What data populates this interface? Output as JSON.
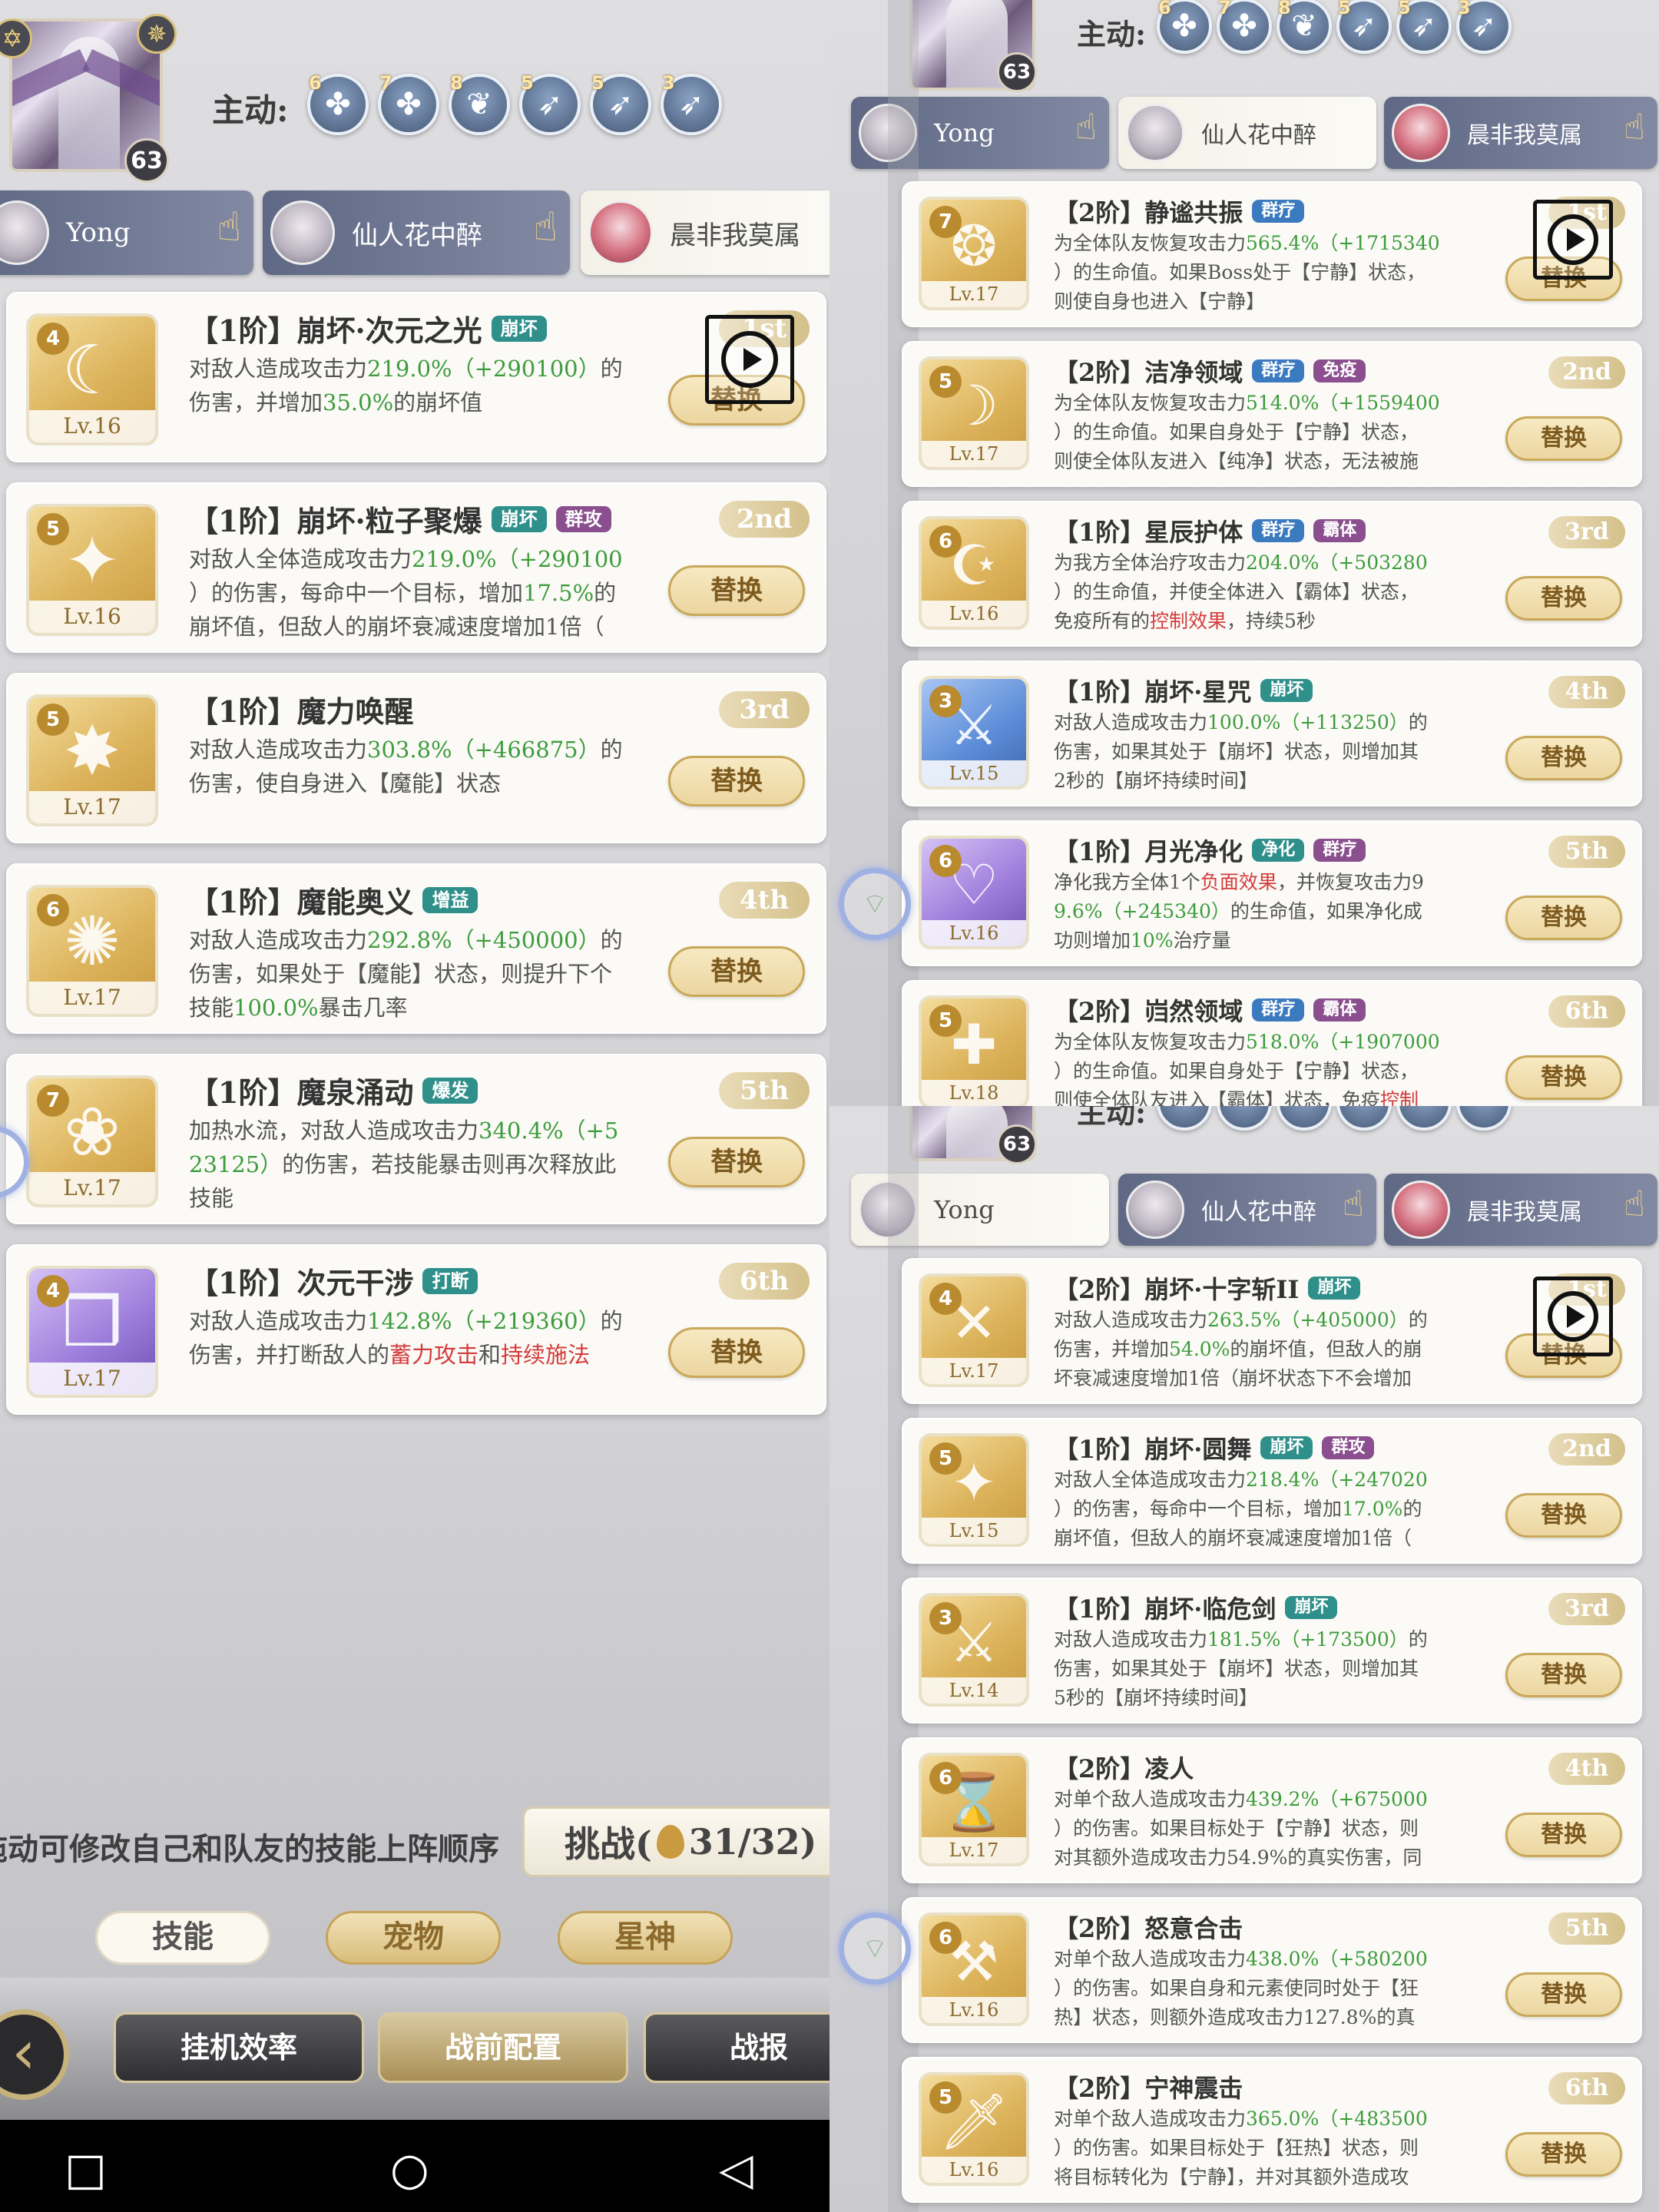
{
  "panelA": {
    "portrait_level": "63",
    "active_label": "主动:",
    "chip_nums": [
      "6",
      "7",
      "8",
      "5",
      "5",
      "3"
    ],
    "tabs": [
      "Yong",
      "仙人花中醉",
      "晨非我莫属"
    ],
    "cards": [
      {
        "gem": "4",
        "lv": "Lv.16",
        "title": "【1阶】崩坏·次元之光",
        "tags": [
          "崩坏"
        ],
        "rank": "1st",
        "swap": "替换",
        "l1a": "对敌人造成攻击力",
        "l1g": "219.0%（+290100）",
        "l1b": "的",
        "l2a": "伤害，并增加",
        "l2g": "35.0%",
        "l2b": "的崩坏值",
        "l3a": "",
        "l3r": "",
        "l3b": ""
      },
      {
        "gem": "5",
        "lv": "Lv.16",
        "title": "【1阶】崩坏·粒子聚爆",
        "tags": [
          "崩坏",
          "群攻"
        ],
        "rank": "2nd",
        "swap": "替换",
        "l1a": "对敌人全体造成攻击力",
        "l1g": "219.0%（+290100",
        "l1b": "",
        "l2a": "）的伤害，每命中一个目标，增加",
        "l2g": "17.5%",
        "l2b": "的",
        "l3a": "崩坏值，但敌人的崩坏衰减速度增加1倍（",
        "l3r": "",
        "l3b": ""
      },
      {
        "gem": "5",
        "lv": "Lv.17",
        "title": "【1阶】魔力唤醒",
        "tags": [],
        "rank": "3rd",
        "swap": "替换",
        "l1a": "对敌人造成攻击力",
        "l1g": "303.8%（+466875）",
        "l1b": "的",
        "l2a": "伤害，使自身进入【魔能】状态",
        "l2g": "",
        "l2b": "",
        "l3a": "",
        "l3r": "",
        "l3b": ""
      },
      {
        "gem": "6",
        "lv": "Lv.17",
        "title": "【1阶】魔能奥义",
        "tags": [
          "增益"
        ],
        "rank": "4th",
        "swap": "替换",
        "l1a": "对敌人造成攻击力",
        "l1g": "292.8%（+450000）",
        "l1b": "的",
        "l2a": "伤害，如果处于【魔能】状态，则提升下个",
        "l2g": "",
        "l2b": "",
        "l3a": "技能",
        "l3g": "100.0%",
        "l3b": "暴击几率"
      },
      {
        "gem": "7",
        "lv": "Lv.17",
        "title": "【1阶】魔泉涌动",
        "tags": [
          "爆发"
        ],
        "rank": "5th",
        "swap": "替换",
        "l1a": "加热水流，对敌人造成攻击力",
        "l1g": "340.4%（+5",
        "l1b": "",
        "l2a": "",
        "l2g": "23125）",
        "l2b": "的伤害，若技能暴击则再次释放此",
        "l3a": "技能",
        "l3r": "",
        "l3b": ""
      },
      {
        "gem": "4",
        "lv": "Lv.17",
        "title": "【1阶】次元干涉",
        "tags": [
          "打断"
        ],
        "rank": "6th",
        "swap": "替换",
        "l1a": "对敌人造成攻击力",
        "l1g": "142.8%（+219360）",
        "l1b": "的",
        "l2a": "伤害，并打断敌人的",
        "l2r": "蓄力攻击",
        "l2c": "和",
        "l2r2": "持续施法",
        "l3a": "",
        "l3r": "",
        "l3b": ""
      }
    ],
    "hint": "拖动可修改自己和队友的技能上阵顺序",
    "challenge": {
      "label": "挑战(",
      "count": "31/32)"
    },
    "bottom_tabs": [
      "技能",
      "宠物",
      "星神"
    ],
    "nav": [
      "挂机效率",
      "战前配置",
      "战报"
    ]
  },
  "panelB": {
    "portrait_level": "63",
    "active_label": "主动:",
    "chip_nums": [
      "6",
      "7",
      "8",
      "5",
      "5",
      "3"
    ],
    "tabs": [
      "Yong",
      "仙人花中醉",
      "晨非我莫属"
    ],
    "cards": [
      {
        "gem": "7",
        "lv": "Lv.17",
        "title": "【2阶】静谧共振",
        "tags": [
          "群疗"
        ],
        "rank": "1st",
        "swap": "替换",
        "l1a": "为全体队友恢复攻击力",
        "l1g": "565.4%（+1715340",
        "l2a": "）的生命值。如果Boss处于【宁静】状态，",
        "l3a": "则使自身也进入【宁静】"
      },
      {
        "gem": "5",
        "lv": "Lv.17",
        "title": "【2阶】洁净领域",
        "tags": [
          "群疗",
          "免疫"
        ],
        "rank": "2nd",
        "swap": "替换",
        "l1a": "为全体队友恢复攻击力",
        "l1g": "514.0%（+1559400",
        "l2a": "）的生命值。如果自身处于【宁静】状态，",
        "l3a": "则使全体队友进入【纯净】状态，无法被施"
      },
      {
        "gem": "6",
        "lv": "Lv.16",
        "title": "【1阶】星辰护体",
        "tags": [
          "群疗",
          "霸体"
        ],
        "rank": "3rd",
        "swap": "替换",
        "l1a": "为我方全体治疗攻击力",
        "l1g": "204.0%（+503280",
        "l2a": "）的生命值，并使全体进入【霸体】状态，",
        "l3a": "免疫所有的",
        "l3r": "控制效果",
        "l3b": "，持续5秒"
      },
      {
        "gem": "3",
        "lv": "Lv.15",
        "title": "【1阶】崩坏·星咒",
        "tags": [
          "崩坏"
        ],
        "rank": "4th",
        "swap": "替换",
        "l1a": "对敌人造成攻击力",
        "l1g": "100.0%（+113250）",
        "l1b": "的",
        "l2a": "伤害，如果其处于【崩坏】状态，则增加其",
        "l3a": "2秒的【崩坏持续时间】"
      },
      {
        "gem": "6",
        "lv": "Lv.16",
        "title": "【1阶】月光净化",
        "tags": [
          "净化",
          "群疗"
        ],
        "rank": "5th",
        "swap": "替换",
        "l1a": "净化我方全体1个",
        "l1r": "负面效果",
        "l1b": "，并恢复攻击力9",
        "l2g": "9.6%（+245340）",
        "l2a": "的生命值，如果净化成",
        "l3a": "功则增加",
        "l3g": "10%",
        "l3b": "治疗量"
      },
      {
        "gem": "5",
        "lv": "Lv.18",
        "title": "【2阶】岿然领域",
        "tags": [
          "群疗",
          "霸体"
        ],
        "rank": "6th",
        "swap": "替换",
        "l1a": "为全体队友恢复攻击力",
        "l1g": "518.0%（+1907000",
        "l2a": "）的生命值。如果自身处于【宁静】状态，",
        "l3a": "则使全体队友进入【霸体】状态，免疫",
        "l3r": "控制"
      }
    ]
  },
  "panelC": {
    "portrait_level": "63",
    "active_label": "主动:",
    "tabs": [
      "Yong",
      "仙人花中醉",
      "晨非我莫属"
    ],
    "cards": [
      {
        "gem": "4",
        "lv": "Lv.17",
        "title": "【2阶】崩坏·十字斩II",
        "tags": [
          "崩坏"
        ],
        "rank": "1st",
        "swap": "替换",
        "l1a": "对敌人造成攻击力",
        "l1g": "263.5%（+405000）",
        "l1b": "的",
        "l2a": "伤害，并增加",
        "l2g": "54.0%",
        "l2b": "的崩坏值，但敌人的崩",
        "l3a": "坏衰减速度增加1倍（崩坏状态下不会增加"
      },
      {
        "gem": "5",
        "lv": "Lv.15",
        "title": "【1阶】崩坏·圆舞",
        "tags": [
          "崩坏",
          "群攻"
        ],
        "rank": "2nd",
        "swap": "替换",
        "l1a": "对敌人全体造成攻击力",
        "l1g": "218.4%（+247020",
        "l2a": "）的伤害，每命中一个目标，增加",
        "l2g": "17.0%",
        "l2b": "的",
        "l3a": "崩坏值，但敌人的崩坏衰减速度增加1倍（"
      },
      {
        "gem": "3",
        "lv": "Lv.14",
        "title": "【1阶】崩坏·临危剑",
        "tags": [
          "崩坏"
        ],
        "rank": "3rd",
        "swap": "替换",
        "l1a": "对敌人造成攻击力",
        "l1g": "181.5%（+173500）",
        "l1b": "的",
        "l2a": "伤害，如果其处于【崩坏】状态，则增加其",
        "l3a": "5秒的【崩坏持续时间】"
      },
      {
        "gem": "6",
        "lv": "Lv.17",
        "title": "【2阶】凌人",
        "tags": [],
        "rank": "4th",
        "swap": "替换",
        "l1a": "对单个敌人造成攻击力",
        "l1g": "439.2%（+675000",
        "l2a": "）的伤害。如果目标处于【宁静】状态，则",
        "l3a": "对其额外造成攻击力54.9%的真实伤害，同"
      },
      {
        "gem": "6",
        "lv": "Lv.16",
        "title": "【2阶】怒意合击",
        "tags": [],
        "rank": "5th",
        "swap": "替换",
        "l1a": "对单个敌人造成攻击力",
        "l1g": "438.0%（+580200",
        "l2a": "）的伤害。如果自身和元素使同时处于【狂",
        "l3a": "热】状态，则额外造成攻击力127.8%的真"
      },
      {
        "gem": "5",
        "lv": "Lv.16",
        "title": "【2阶】宁神震击",
        "tags": [],
        "rank": "6th",
        "swap": "替换",
        "l1a": "对单个敌人造成攻击力",
        "l1g": "365.0%（+483500",
        "l2a": "）的伤害。如果目标处于【狂热】状态，则",
        "l3a": "将目标转化为【宁静】，并对其额外造成攻"
      }
    ]
  },
  "icons": {
    "play": "play-icon",
    "hand": "pointing-hand-icon",
    "star": "star-icon",
    "back": "back-arrow-icon"
  }
}
